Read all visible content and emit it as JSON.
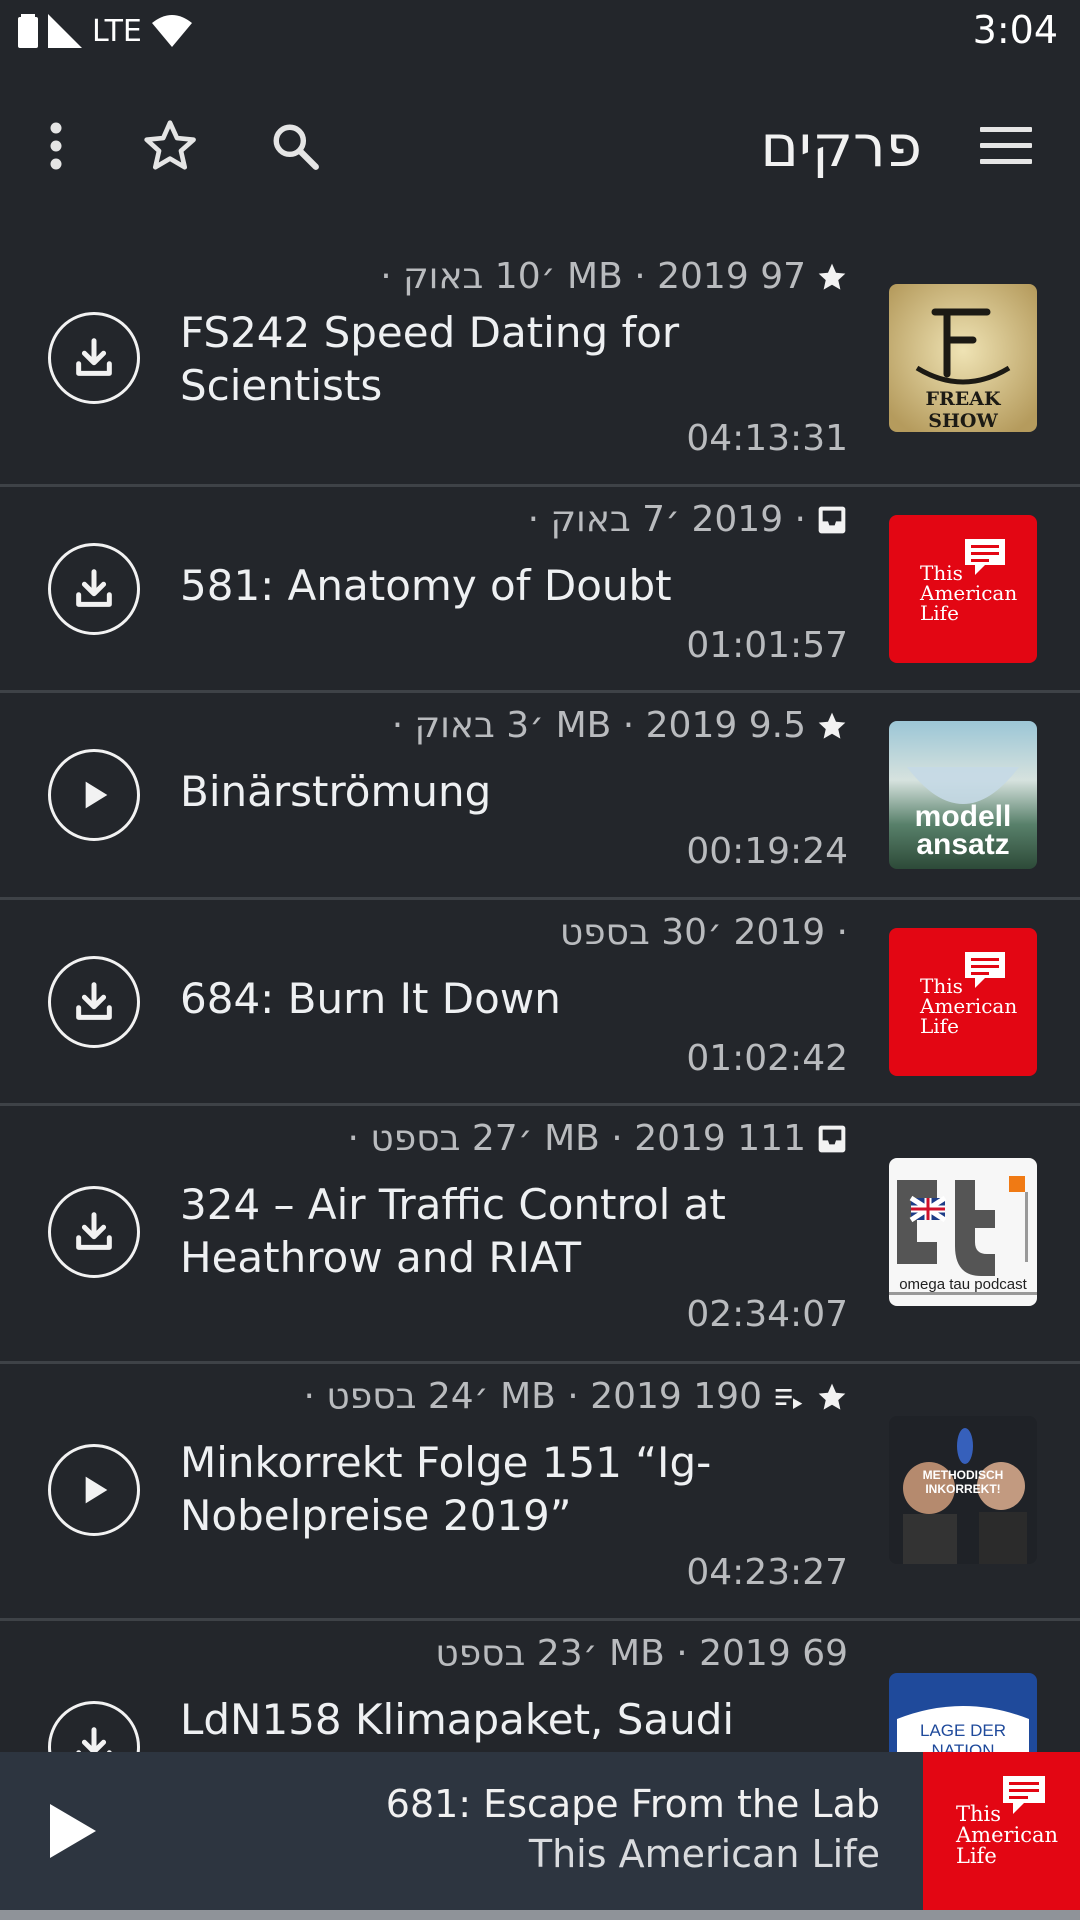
{
  "status_bar": {
    "network": "LTE",
    "time": "3:04"
  },
  "toolbar": {
    "title": "פרקים"
  },
  "episodes": [
    {
      "meta": "97 MB · 2019 ׳10 באוק ·",
      "meta_icon": "star-icon",
      "title": "FS242 Speed Dating for Scientists",
      "duration": "04:13:31",
      "action": "download",
      "thumb_text": "FREAK SHOW"
    },
    {
      "meta": "· 2019 ׳7 באוק ·",
      "meta_icon": "inbox-icon",
      "title": "581: Anatomy of Doubt",
      "duration": "01:01:57",
      "action": "download",
      "thumb_text": "This American Life"
    },
    {
      "meta": "9.5 MB · 2019 ׳3 באוק ·",
      "meta_icon": "star-icon",
      "title": "Binärströmung",
      "duration": "00:19:24",
      "action": "play",
      "thumb_text": "modell ansatz"
    },
    {
      "meta": "· 2019 ׳30 בספט",
      "meta_icon": "",
      "title": "684: Burn It Down",
      "duration": "01:02:42",
      "action": "download",
      "thumb_text": "This American Life"
    },
    {
      "meta": "111 MB · 2019 ׳27 בספט ·",
      "meta_icon": "inbox-icon",
      "title": "324 – Air Traffic Control at Heathrow and RIAT",
      "duration": "02:34:07",
      "action": "download",
      "thumb_text": "omega tau podcast"
    },
    {
      "meta": "190 MB · 2019 ׳24 בספט ·",
      "meta_icon": "queue-star-icons",
      "title": "Minkorrekt Folge 151 “Ig-Nobelpreise 2019”",
      "duration": "04:23:27",
      "action": "play",
      "thumb_text": "METHODISCH INKORREKT!"
    },
    {
      "meta": "69 MB · 2019 ׳23 בספט",
      "meta_icon": "",
      "title": "LdN158 Klimapaket, Saudi",
      "duration": "",
      "action": "download",
      "thumb_text": "LAGE DER NATION"
    }
  ],
  "now_playing": {
    "episode": "681: Escape From the Lab",
    "podcast": "This American Life",
    "thumb_text": "This American Life"
  },
  "colors": {
    "background": "#23262b",
    "player": "#2d3540",
    "tal_red": "#e30613",
    "lage_blue": "#1f4a9b"
  }
}
